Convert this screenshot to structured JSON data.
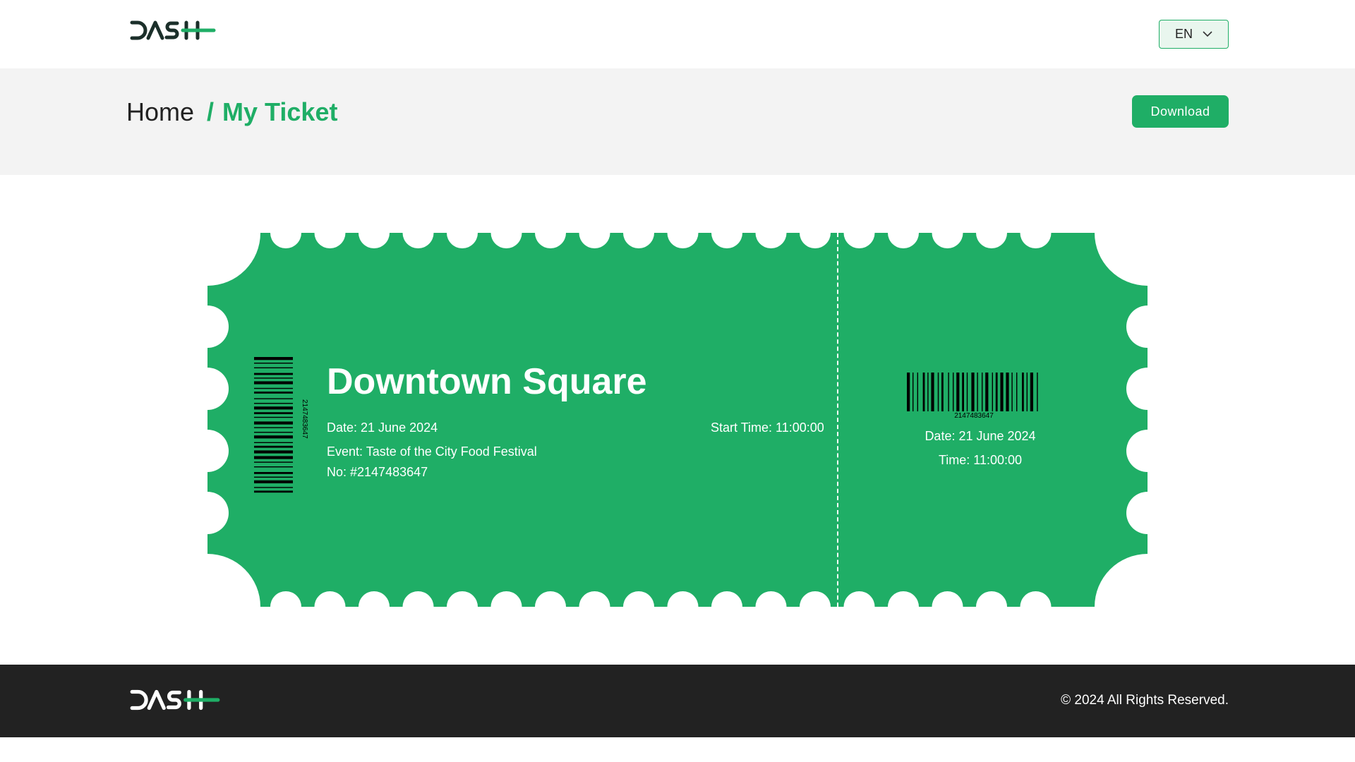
{
  "header": {
    "brand": "DASH",
    "language": "EN"
  },
  "breadcrumb": {
    "home": "Home",
    "separator": "/",
    "current": "My Ticket"
  },
  "actions": {
    "download_label": "Download"
  },
  "ticket": {
    "title": "Downtown Square",
    "date": "Date: 21 June 2024",
    "start_time": "Start Time: 11:00:00",
    "event": "Event: Taste of the City Food Festival",
    "number": "No: #2147483647",
    "barcode_value": "2147483647",
    "stub": {
      "date": "Date: 21 June 2024",
      "time": "Time: 11:00:00"
    }
  },
  "footer": {
    "copyright": "© 2024 All Rights Reserved."
  },
  "colors": {
    "accent": "#1fae66",
    "footer_bg": "#222222",
    "band_bg": "#f3f3f3"
  }
}
